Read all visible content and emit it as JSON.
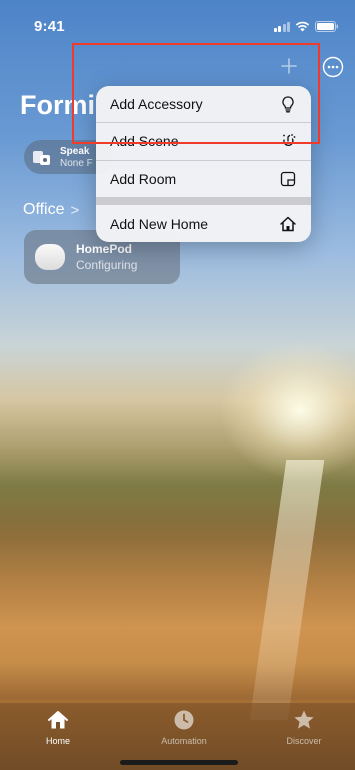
{
  "status": {
    "time": "9:41"
  },
  "header": {
    "title": "Formi"
  },
  "speaker_chip": {
    "title": "Speak",
    "subtitle": "None F"
  },
  "room": {
    "name": "Office",
    "chevron": ">"
  },
  "accessory": {
    "name": "HomePod",
    "status": "Configuring"
  },
  "menu": {
    "items": [
      {
        "label": "Add Accessory",
        "icon": "lightbulb-icon"
      },
      {
        "label": "Add Scene",
        "icon": "scene-icon"
      },
      {
        "label": "Add Room",
        "icon": "room-icon"
      },
      {
        "label": "Add New Home",
        "icon": "house-icon"
      }
    ]
  },
  "tabs": [
    {
      "label": "Home",
      "icon": "house-icon",
      "active": true
    },
    {
      "label": "Automation",
      "icon": "clock-icon",
      "active": false
    },
    {
      "label": "Discover",
      "icon": "star-icon",
      "active": false
    }
  ],
  "colors": {
    "highlight": "#f03a2a"
  }
}
